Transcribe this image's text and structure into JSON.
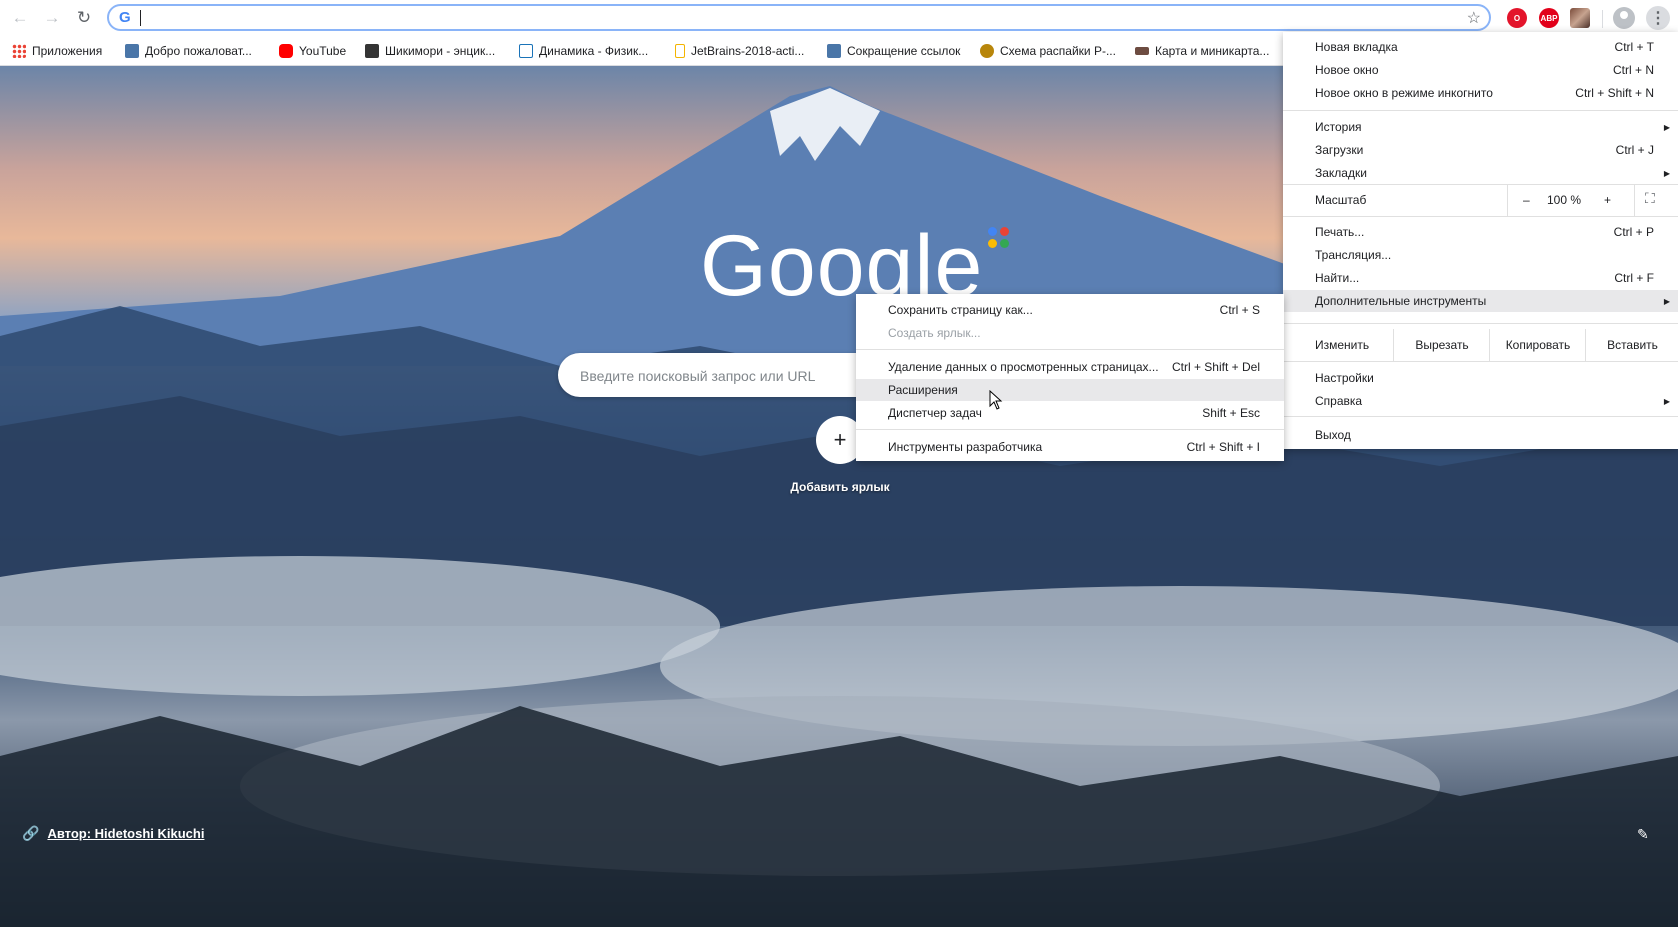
{
  "toolbar": {
    "omnibox_value": "",
    "google_icon": "G"
  },
  "bookmarks": [
    {
      "label": "Приложения",
      "icon": "apps-icon",
      "color": "#4285f4"
    },
    {
      "label": "Добро пожаловат...",
      "icon": "vk-icon",
      "color": "#4a76a8"
    },
    {
      "label": "YouTube",
      "icon": "youtube-icon",
      "color": "#ff0000"
    },
    {
      "label": "Шикимори - энцик...",
      "icon": "shikimori-icon",
      "color": "#343434"
    },
    {
      "label": "Динамика - Физик...",
      "icon": "physics-icon",
      "color": "#1a73b8"
    },
    {
      "label": "JetBrains-2018-acti...",
      "icon": "document-icon",
      "color": "#f4b400"
    },
    {
      "label": "Сокращение ссылок",
      "icon": "vk-icon",
      "color": "#4a76a8"
    },
    {
      "label": "Схема распайки Р-...",
      "icon": "cable-icon",
      "color": "#b8860b"
    },
    {
      "label": "Карта и миникарта...",
      "icon": "map-icon",
      "color": "#6d4c41"
    }
  ],
  "ntp": {
    "logo_text": "Google",
    "search_placeholder": "Введите поисковый запрос или URL",
    "add_shortcut_label": "Добавить ярлык",
    "attribution_text": "Автор: Hidetoshi Kikuchi"
  },
  "main_menu": {
    "new_tab": {
      "label": "Новая вкладка",
      "shortcut": "Ctrl + T"
    },
    "new_window": {
      "label": "Новое окно",
      "shortcut": "Ctrl + N"
    },
    "incognito": {
      "label": "Новое окно в режиме инкогнито",
      "shortcut": "Ctrl + Shift + N"
    },
    "history": {
      "label": "История"
    },
    "downloads": {
      "label": "Загрузки",
      "shortcut": "Ctrl + J"
    },
    "bookmarks": {
      "label": "Закладки"
    },
    "zoom": {
      "label": "Масштаб",
      "minus": "–",
      "value": "100 %",
      "plus": "+"
    },
    "print": {
      "label": "Печать...",
      "shortcut": "Ctrl + P"
    },
    "cast": {
      "label": "Трансляция..."
    },
    "find": {
      "label": "Найти...",
      "shortcut": "Ctrl + F"
    },
    "more_tools": {
      "label": "Дополнительные инструменты"
    },
    "edit": {
      "label": "Изменить",
      "cut": "Вырезать",
      "copy": "Копировать",
      "paste": "Вставить"
    },
    "settings": {
      "label": "Настройки"
    },
    "help": {
      "label": "Справка"
    },
    "exit": {
      "label": "Выход"
    }
  },
  "sub_menu": {
    "save_page": {
      "label": "Сохранить страницу как...",
      "shortcut": "Ctrl + S"
    },
    "create_shortcut": {
      "label": "Создать ярлык..."
    },
    "clear_data": {
      "label": "Удаление данных о просмотренных страницах...",
      "shortcut": "Ctrl + Shift + Del"
    },
    "extensions": {
      "label": "Расширения"
    },
    "task_manager": {
      "label": "Диспетчер задач",
      "shortcut": "Shift + Esc"
    },
    "dev_tools": {
      "label": "Инструменты разработчика",
      "shortcut": "Ctrl + Shift + I"
    }
  },
  "colors": {
    "accent": "#8ab4f8",
    "menu_highlight": "#e8e8ea"
  }
}
